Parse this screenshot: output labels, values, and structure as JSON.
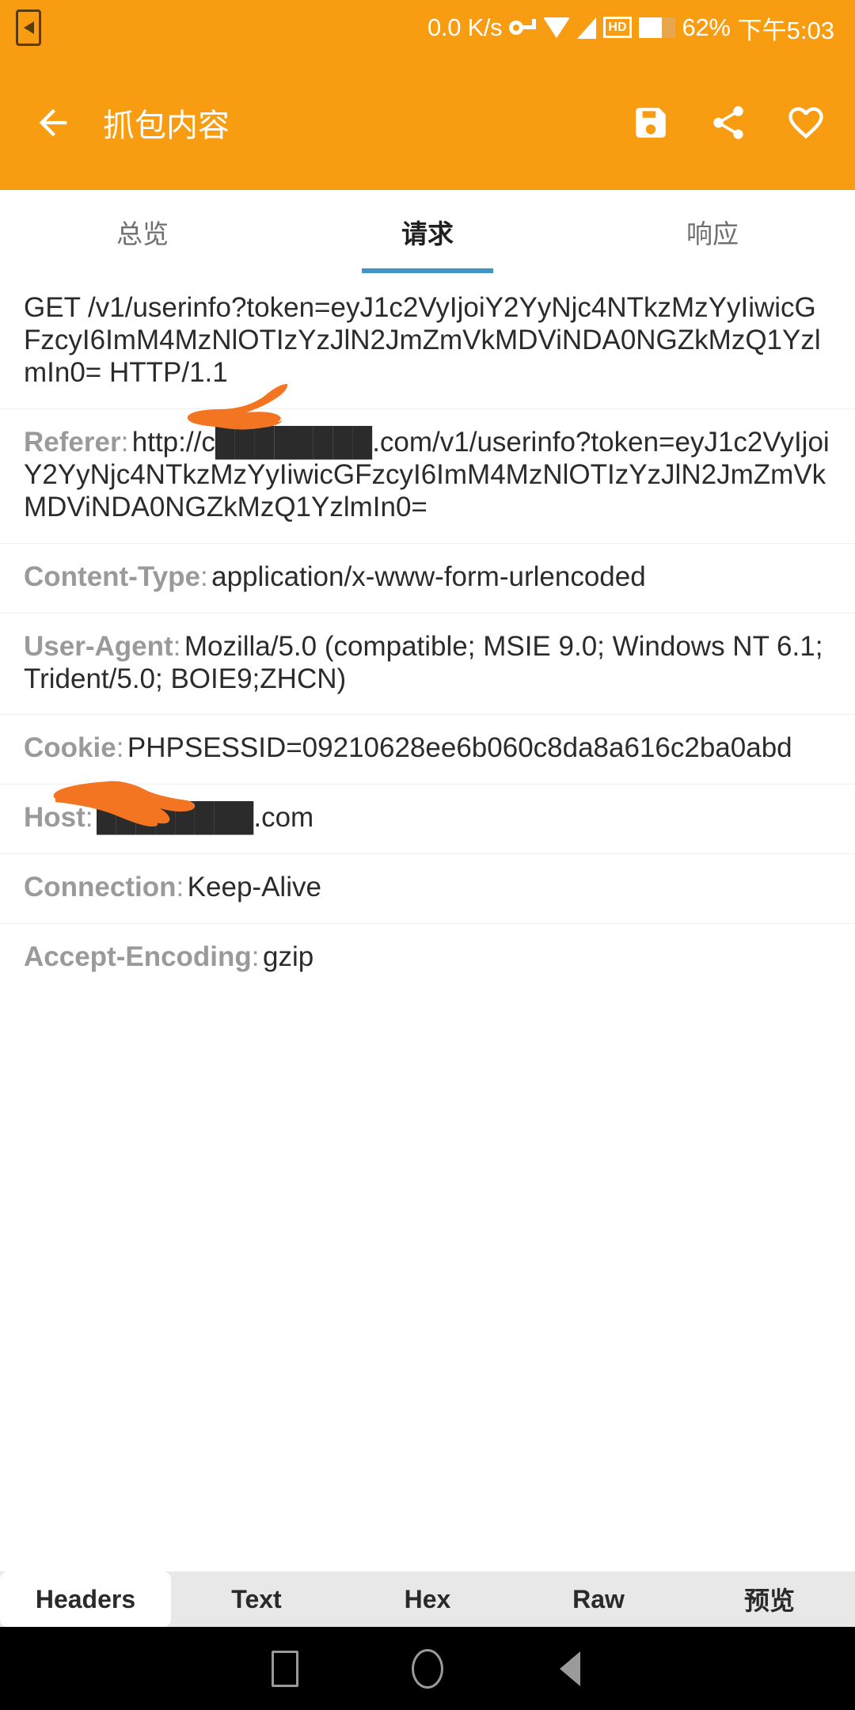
{
  "status_bar": {
    "network_speed": "0.0 K/s",
    "battery_percent": "62%",
    "time": "下午5:03",
    "icons": [
      "phone-cast-icon",
      "vpn-key-icon",
      "wifi-icon",
      "signal-icon",
      "hd-icon",
      "battery-icon"
    ],
    "hd_label": "HD"
  },
  "app_bar": {
    "title": "抓包内容",
    "back_icon": "arrow-back-icon",
    "actions": [
      {
        "name": "save-icon",
        "label": "保存"
      },
      {
        "name": "share-icon",
        "label": "分享"
      },
      {
        "name": "heart-icon",
        "label": "收藏"
      }
    ]
  },
  "top_tabs": {
    "items": [
      {
        "label": "总览",
        "active": false
      },
      {
        "label": "请求",
        "active": true
      },
      {
        "label": "响应",
        "active": false
      }
    ],
    "indicator_color": "#3f95c7"
  },
  "request": {
    "start_line": "GET /v1/userinfo?token=eyJ1c2VyIjoiY2YyNjc4NTkzMzYyIiwicGFzcyI6ImM4MzNlOTIzYzJlN2JmZmVkMDViNDA0NGZkMzQ1YzlmIn0= HTTP/1.1",
    "headers": [
      {
        "name": "Referer",
        "value": "http://c████████.com/v1/userinfo?token=eyJ1c2VyIjoiY2YyNjc4NTkzMzYyIiwicGFzcyI6ImM4MzNlOTIzYzJlN2JmZmVkMDViNDA0NGZkMzQ1YzlmIn0=",
        "redacted": true
      },
      {
        "name": "Content-Type",
        "value": "application/x-www-form-urlencoded",
        "redacted": false
      },
      {
        "name": "User-Agent",
        "value": "Mozilla/5.0 (compatible; MSIE 9.0; Windows NT 6.1; Trident/5.0; BOIE9;ZHCN)",
        "redacted": false
      },
      {
        "name": "Cookie",
        "value": "PHPSESSID=09210628ee6b060c8da8a616c2ba0abd",
        "redacted": false
      },
      {
        "name": "Host",
        "value": "████████.com",
        "redacted": true
      },
      {
        "name": "Connection",
        "value": "Keep-Alive",
        "redacted": false
      },
      {
        "name": "Accept-Encoding",
        "value": "gzip",
        "redacted": false
      }
    ]
  },
  "bottom_tabs": {
    "items": [
      {
        "label": "Headers",
        "active": true
      },
      {
        "label": "Text",
        "active": false
      },
      {
        "label": "Hex",
        "active": false
      },
      {
        "label": "Raw",
        "active": false
      },
      {
        "label": "预览",
        "active": false
      }
    ]
  },
  "nav_bar": {
    "buttons": [
      {
        "name": "recents-button"
      },
      {
        "name": "home-button"
      },
      {
        "name": "back-button"
      }
    ]
  },
  "colors": {
    "accent_orange": "#F89C11",
    "tab_indicator_blue": "#3f95c7",
    "redaction_orange": "#F47521",
    "header_label_gray": "#9a9a9a",
    "value_dark": "#2b2b2b"
  }
}
